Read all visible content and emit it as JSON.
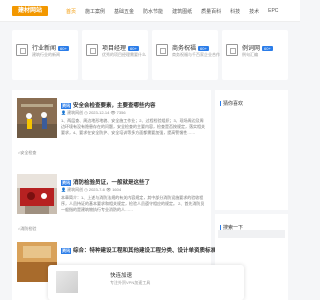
{
  "header": {
    "logo": "建材网站",
    "nav": [
      "首页",
      "施工案例",
      "基础五金",
      "防水节能",
      "建筑图纸",
      "质量百科",
      "科技",
      "技术",
      "EPC"
    ]
  },
  "cards": [
    {
      "title": "行业新闻",
      "badge": "60+",
      "desc": "建筑行业的新闻"
    },
    {
      "title": "项目经理",
      "badge": "60+",
      "desc": "优秀的项目经理需要什么"
    },
    {
      "title": "商务祝福",
      "badge": "60+",
      "desc": "商务祝福与千百家企业合作"
    },
    {
      "title": "例词网",
      "badge": "60+",
      "desc": "例句汇编"
    }
  ],
  "articles": [
    {
      "category": "资讯",
      "title": "安全会检查要素，主要查哪些内容",
      "author": "建筑网创",
      "date": "2023-12-14",
      "views": "7356",
      "body": "1、两层查、周边地形地貌、安全施工作业；2、过程检验组织；3、现场周边及周边环境有没有隐患存在的问题，安全检查的主要内容，检查是否按规定，落实相关要求，4、要求在安全防护、安全培训等多方面都需要加强，提高警惕性……",
      "tag": "安全检查"
    },
    {
      "category": "资讯",
      "title": "消防检验员证，一般就是这些了",
      "author": "建筑网创",
      "date": "2023-7-6",
      "views": "1604",
      "body": "本章简介：1、上述与消防法规的有关内容规定，其中部分消防设施要求的验收程序，人员持证的基本要求和相关规定，检验人员遵守相应的规定。 2、首先消防员一般指的是建筑物执行专业消防的人……",
      "tag": "消防检验"
    },
    {
      "category": "资讯",
      "title": "综合：特种建设工程和其他建设工程分类、设计单资质标准如何",
      "author": "",
      "date": "",
      "views": "",
      "body": "",
      "tag": ""
    }
  ],
  "sidebar": {
    "section1_title": "猜你喜欢",
    "section2_title": "搜索一下"
  },
  "popup": {
    "title": "快连加速",
    "subtitle": "专注外贸VPN加速工具"
  }
}
